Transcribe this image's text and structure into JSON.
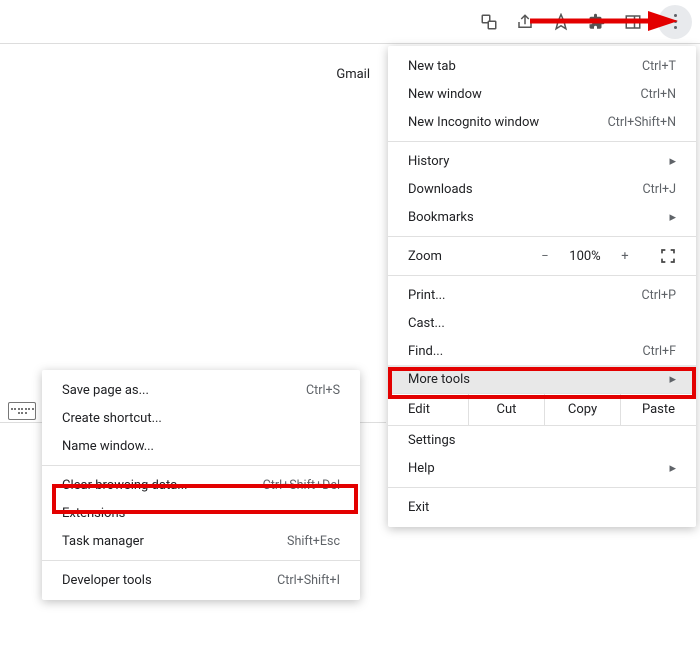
{
  "page": {
    "gmail": "Gmail"
  },
  "main_menu": {
    "new_tab": "New tab",
    "new_tab_sc": "Ctrl+T",
    "new_window": "New window",
    "new_window_sc": "Ctrl+N",
    "incognito": "New Incognito window",
    "incognito_sc": "Ctrl+Shift+N",
    "history": "History",
    "downloads": "Downloads",
    "downloads_sc": "Ctrl+J",
    "bookmarks": "Bookmarks",
    "zoom": "Zoom",
    "zoom_minus": "−",
    "zoom_val": "100%",
    "zoom_plus": "+",
    "print": "Print...",
    "print_sc": "Ctrl+P",
    "cast": "Cast...",
    "find": "Find...",
    "find_sc": "Ctrl+F",
    "more_tools": "More tools",
    "edit": "Edit",
    "cut": "Cut",
    "copy": "Copy",
    "paste": "Paste",
    "settings": "Settings",
    "help": "Help",
    "exit": "Exit"
  },
  "sub_menu": {
    "save_page": "Save page as...",
    "save_page_sc": "Ctrl+S",
    "create_shortcut": "Create shortcut...",
    "name_window": "Name window...",
    "clear_browsing": "Clear browsing data...",
    "clear_browsing_sc": "Ctrl+Shift+Del",
    "extensions": "Extensions",
    "task_manager": "Task manager",
    "task_manager_sc": "Shift+Esc",
    "dev_tools": "Developer tools",
    "dev_tools_sc": "Ctrl+Shift+I"
  }
}
